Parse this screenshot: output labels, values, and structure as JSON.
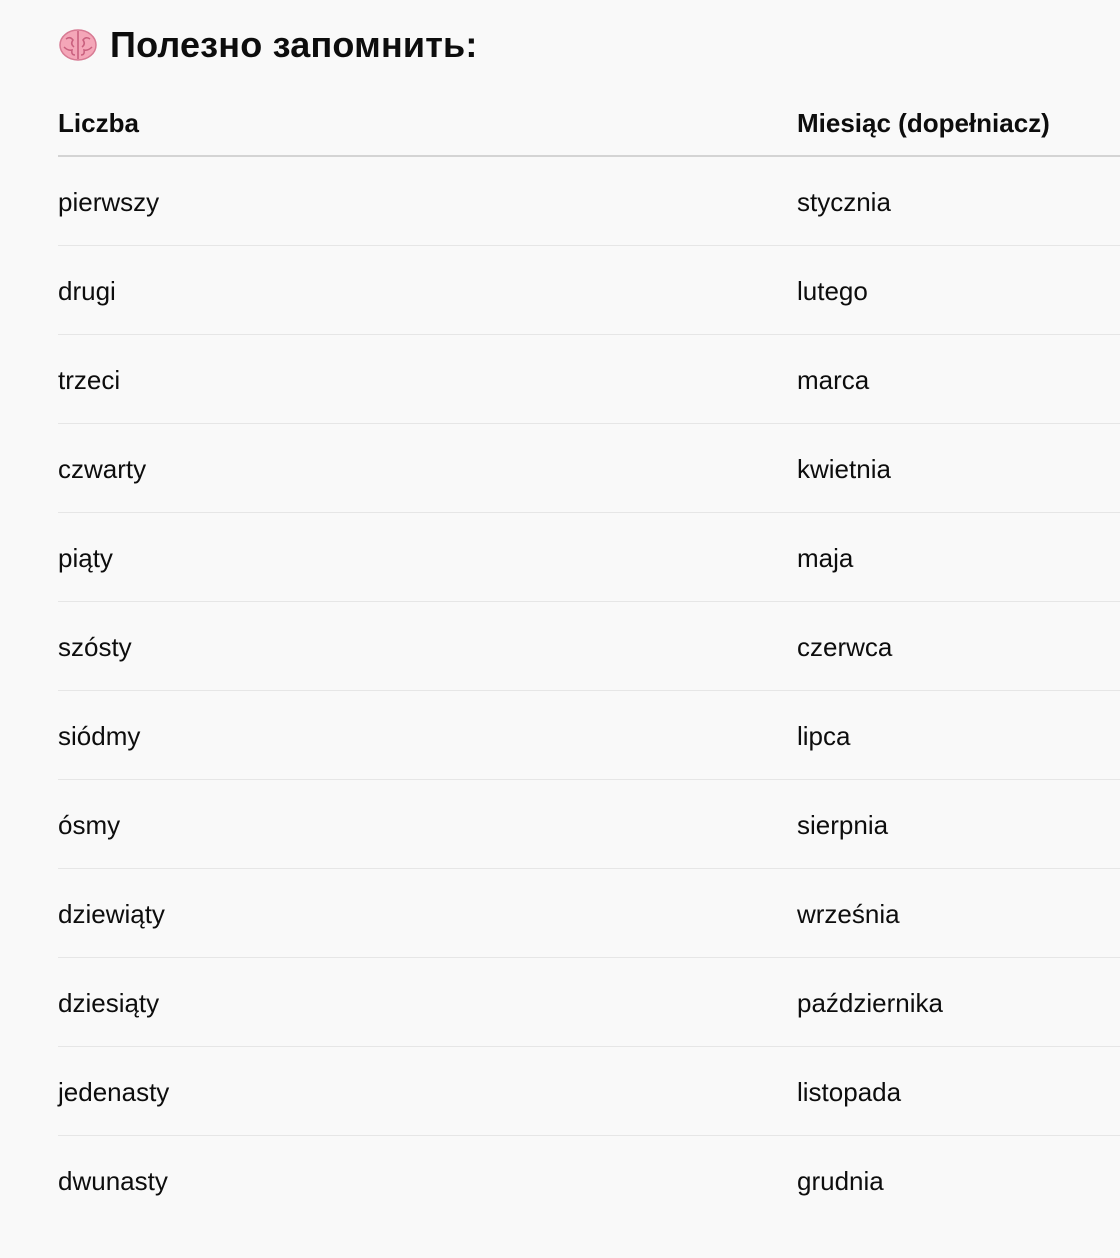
{
  "heading": {
    "icon": "brain-icon",
    "text": "Полезно запомнить:"
  },
  "table": {
    "columns": [
      "Liczba",
      "Miesiąc (dopełniacz)"
    ],
    "rows": [
      [
        "pierwszy",
        "stycznia"
      ],
      [
        "drugi",
        "lutego"
      ],
      [
        "trzeci",
        "marca"
      ],
      [
        "czwarty",
        "kwietnia"
      ],
      [
        "piąty",
        "maja"
      ],
      [
        "szósty",
        "czerwca"
      ],
      [
        "siódmy",
        "lipca"
      ],
      [
        "ósmy",
        "sierpnia"
      ],
      [
        "dziewiąty",
        "września"
      ],
      [
        "dziesiąty",
        "października"
      ],
      [
        "jedenasty",
        "listopada"
      ],
      [
        "dwunasty",
        "grudnia"
      ]
    ]
  },
  "colors": {
    "background": "#f9f9f9",
    "text": "#0d0d0d",
    "row_divider": "#e6e6e6",
    "header_divider": "#d4d4d4",
    "brain": "#f4a6b8"
  }
}
